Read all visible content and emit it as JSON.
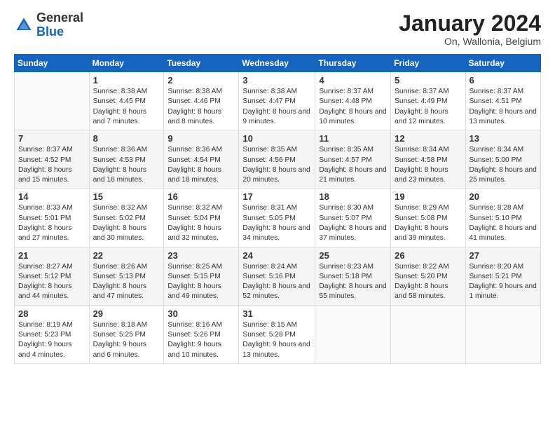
{
  "header": {
    "logo_general": "General",
    "logo_blue": "Blue",
    "month_title": "January 2024",
    "subtitle": "On, Wallonia, Belgium"
  },
  "days_of_week": [
    "Sunday",
    "Monday",
    "Tuesday",
    "Wednesday",
    "Thursday",
    "Friday",
    "Saturday"
  ],
  "weeks": [
    [
      {
        "day": "",
        "empty": true
      },
      {
        "day": "1",
        "sunrise": "Sunrise: 8:38 AM",
        "sunset": "Sunset: 4:45 PM",
        "daylight": "Daylight: 8 hours and 7 minutes."
      },
      {
        "day": "2",
        "sunrise": "Sunrise: 8:38 AM",
        "sunset": "Sunset: 4:46 PM",
        "daylight": "Daylight: 8 hours and 8 minutes."
      },
      {
        "day": "3",
        "sunrise": "Sunrise: 8:38 AM",
        "sunset": "Sunset: 4:47 PM",
        "daylight": "Daylight: 8 hours and 9 minutes."
      },
      {
        "day": "4",
        "sunrise": "Sunrise: 8:37 AM",
        "sunset": "Sunset: 4:48 PM",
        "daylight": "Daylight: 8 hours and 10 minutes."
      },
      {
        "day": "5",
        "sunrise": "Sunrise: 8:37 AM",
        "sunset": "Sunset: 4:49 PM",
        "daylight": "Daylight: 8 hours and 12 minutes."
      },
      {
        "day": "6",
        "sunrise": "Sunrise: 8:37 AM",
        "sunset": "Sunset: 4:51 PM",
        "daylight": "Daylight: 8 hours and 13 minutes."
      }
    ],
    [
      {
        "day": "7",
        "sunrise": "Sunrise: 8:37 AM",
        "sunset": "Sunset: 4:52 PM",
        "daylight": "Daylight: 8 hours and 15 minutes."
      },
      {
        "day": "8",
        "sunrise": "Sunrise: 8:36 AM",
        "sunset": "Sunset: 4:53 PM",
        "daylight": "Daylight: 8 hours and 16 minutes."
      },
      {
        "day": "9",
        "sunrise": "Sunrise: 8:36 AM",
        "sunset": "Sunset: 4:54 PM",
        "daylight": "Daylight: 8 hours and 18 minutes."
      },
      {
        "day": "10",
        "sunrise": "Sunrise: 8:35 AM",
        "sunset": "Sunset: 4:56 PM",
        "daylight": "Daylight: 8 hours and 20 minutes."
      },
      {
        "day": "11",
        "sunrise": "Sunrise: 8:35 AM",
        "sunset": "Sunset: 4:57 PM",
        "daylight": "Daylight: 8 hours and 21 minutes."
      },
      {
        "day": "12",
        "sunrise": "Sunrise: 8:34 AM",
        "sunset": "Sunset: 4:58 PM",
        "daylight": "Daylight: 8 hours and 23 minutes."
      },
      {
        "day": "13",
        "sunrise": "Sunrise: 8:34 AM",
        "sunset": "Sunset: 5:00 PM",
        "daylight": "Daylight: 8 hours and 25 minutes."
      }
    ],
    [
      {
        "day": "14",
        "sunrise": "Sunrise: 8:33 AM",
        "sunset": "Sunset: 5:01 PM",
        "daylight": "Daylight: 8 hours and 27 minutes."
      },
      {
        "day": "15",
        "sunrise": "Sunrise: 8:32 AM",
        "sunset": "Sunset: 5:02 PM",
        "daylight": "Daylight: 8 hours and 30 minutes."
      },
      {
        "day": "16",
        "sunrise": "Sunrise: 8:32 AM",
        "sunset": "Sunset: 5:04 PM",
        "daylight": "Daylight: 8 hours and 32 minutes."
      },
      {
        "day": "17",
        "sunrise": "Sunrise: 8:31 AM",
        "sunset": "Sunset: 5:05 PM",
        "daylight": "Daylight: 8 hours and 34 minutes."
      },
      {
        "day": "18",
        "sunrise": "Sunrise: 8:30 AM",
        "sunset": "Sunset: 5:07 PM",
        "daylight": "Daylight: 8 hours and 37 minutes."
      },
      {
        "day": "19",
        "sunrise": "Sunrise: 8:29 AM",
        "sunset": "Sunset: 5:08 PM",
        "daylight": "Daylight: 8 hours and 39 minutes."
      },
      {
        "day": "20",
        "sunrise": "Sunrise: 8:28 AM",
        "sunset": "Sunset: 5:10 PM",
        "daylight": "Daylight: 8 hours and 41 minutes."
      }
    ],
    [
      {
        "day": "21",
        "sunrise": "Sunrise: 8:27 AM",
        "sunset": "Sunset: 5:12 PM",
        "daylight": "Daylight: 8 hours and 44 minutes."
      },
      {
        "day": "22",
        "sunrise": "Sunrise: 8:26 AM",
        "sunset": "Sunset: 5:13 PM",
        "daylight": "Daylight: 8 hours and 47 minutes."
      },
      {
        "day": "23",
        "sunrise": "Sunrise: 8:25 AM",
        "sunset": "Sunset: 5:15 PM",
        "daylight": "Daylight: 8 hours and 49 minutes."
      },
      {
        "day": "24",
        "sunrise": "Sunrise: 8:24 AM",
        "sunset": "Sunset: 5:16 PM",
        "daylight": "Daylight: 8 hours and 52 minutes."
      },
      {
        "day": "25",
        "sunrise": "Sunrise: 8:23 AM",
        "sunset": "Sunset: 5:18 PM",
        "daylight": "Daylight: 8 hours and 55 minutes."
      },
      {
        "day": "26",
        "sunrise": "Sunrise: 8:22 AM",
        "sunset": "Sunset: 5:20 PM",
        "daylight": "Daylight: 8 hours and 58 minutes."
      },
      {
        "day": "27",
        "sunrise": "Sunrise: 8:20 AM",
        "sunset": "Sunset: 5:21 PM",
        "daylight": "Daylight: 9 hours and 1 minute."
      }
    ],
    [
      {
        "day": "28",
        "sunrise": "Sunrise: 8:19 AM",
        "sunset": "Sunset: 5:23 PM",
        "daylight": "Daylight: 9 hours and 4 minutes."
      },
      {
        "day": "29",
        "sunrise": "Sunrise: 8:18 AM",
        "sunset": "Sunset: 5:25 PM",
        "daylight": "Daylight: 9 hours and 6 minutes."
      },
      {
        "day": "30",
        "sunrise": "Sunrise: 8:16 AM",
        "sunset": "Sunset: 5:26 PM",
        "daylight": "Daylight: 9 hours and 10 minutes."
      },
      {
        "day": "31",
        "sunrise": "Sunrise: 8:15 AM",
        "sunset": "Sunset: 5:28 PM",
        "daylight": "Daylight: 9 hours and 13 minutes."
      },
      {
        "day": "",
        "empty": true
      },
      {
        "day": "",
        "empty": true
      },
      {
        "day": "",
        "empty": true
      }
    ]
  ]
}
